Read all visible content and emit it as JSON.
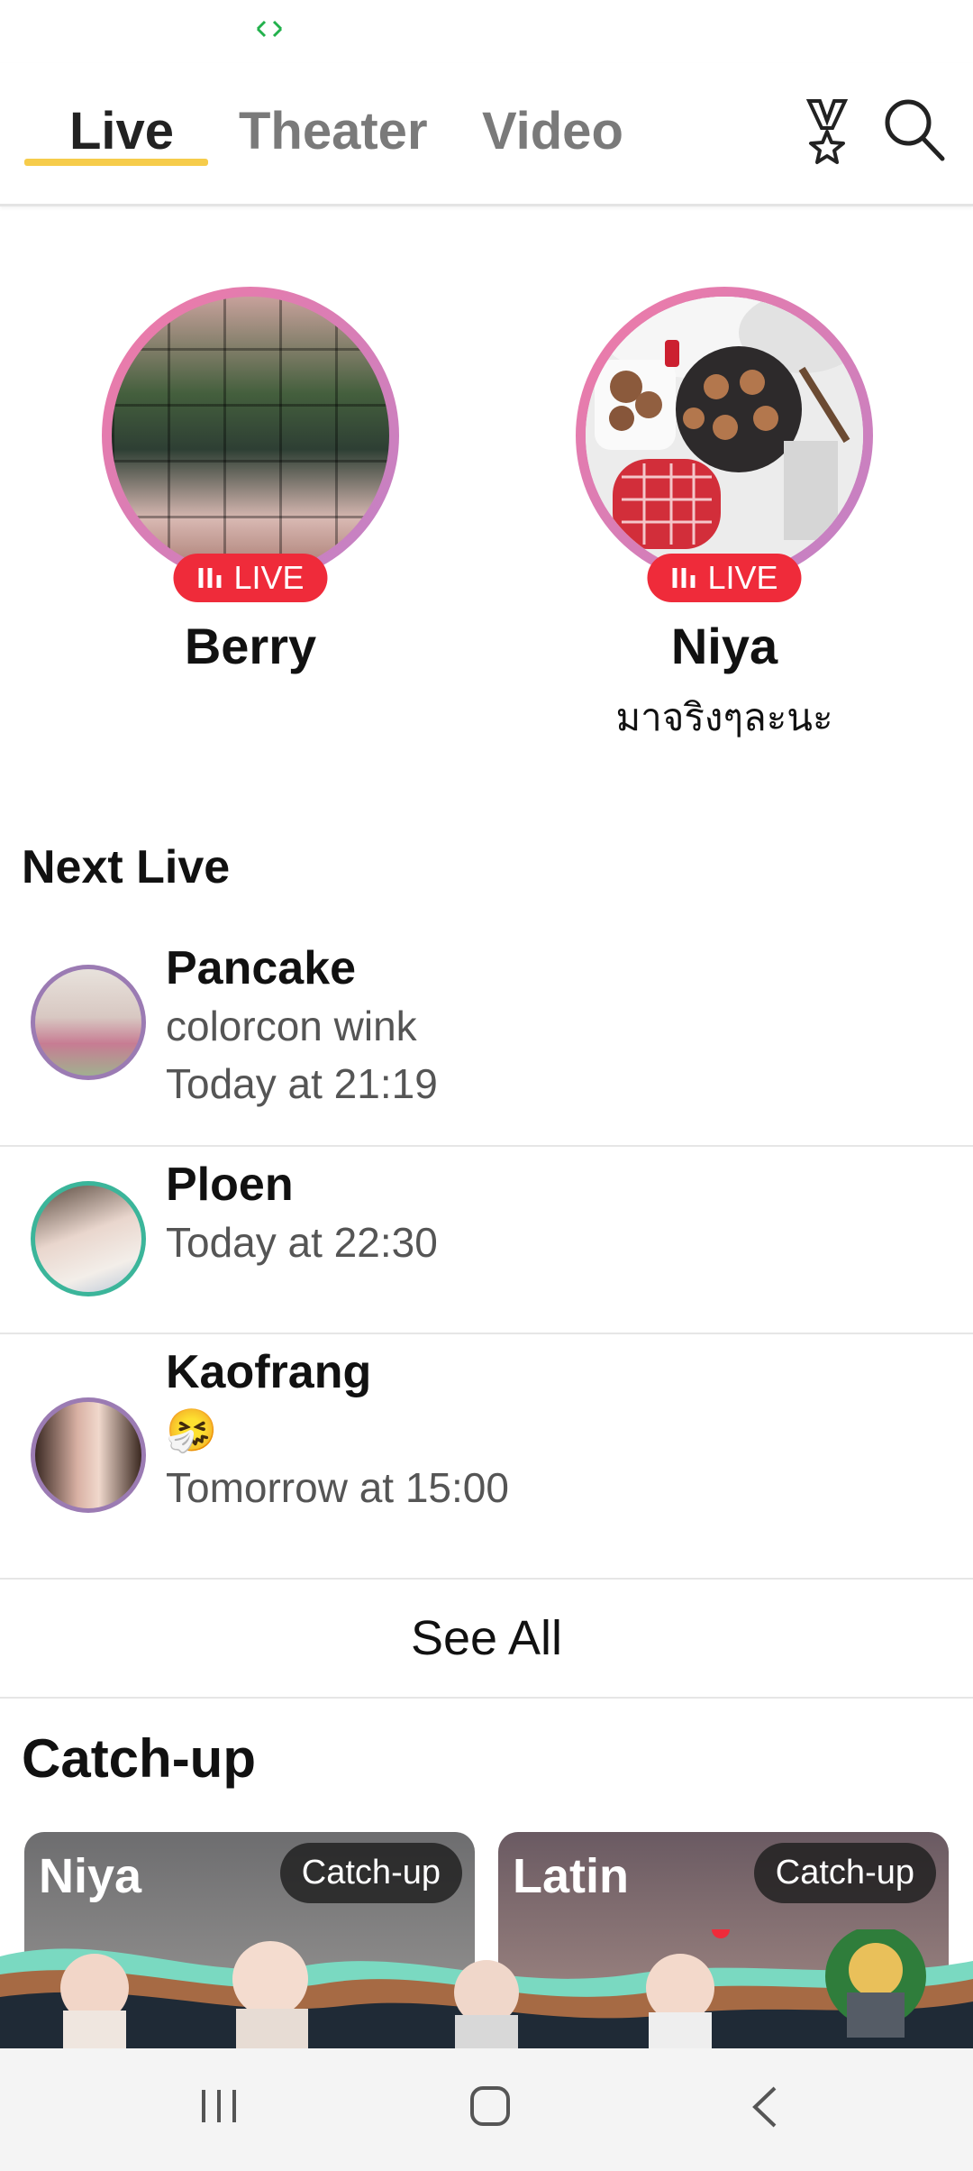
{
  "tabs": [
    {
      "label": "Live",
      "active": true
    },
    {
      "label": "Theater",
      "active": false
    },
    {
      "label": "Video",
      "active": false
    }
  ],
  "toolbar": {
    "trophy_icon": "medal-icon",
    "search_icon": "search-icon"
  },
  "live_now": [
    {
      "name": "Berry",
      "badge": "LIVE",
      "subtitle": ""
    },
    {
      "name": "Niya",
      "badge": "LIVE",
      "subtitle": "มาจริงๆละนะ"
    }
  ],
  "next_live": {
    "title": "Next Live",
    "items": [
      {
        "name": "Pancake",
        "note": "colorcon wink",
        "time": "Today at 21:19"
      },
      {
        "name": "Ploen",
        "time": "Today at 22:30"
      },
      {
        "name": "Kaofrang",
        "note": "🤧",
        "time": "Tomorrow at 15:00"
      }
    ],
    "see_all": "See All"
  },
  "catch_up": {
    "title": "Catch-up",
    "cards": [
      {
        "name": "Niya",
        "tag": "Catch-up"
      },
      {
        "name": "Latin",
        "tag": "Catch-up"
      }
    ]
  },
  "colors": {
    "accent": "#f6cc4b",
    "live_red": "#ef2b3a",
    "ring_pink": "#f07aa6",
    "ring_purple": "#c082c7"
  }
}
